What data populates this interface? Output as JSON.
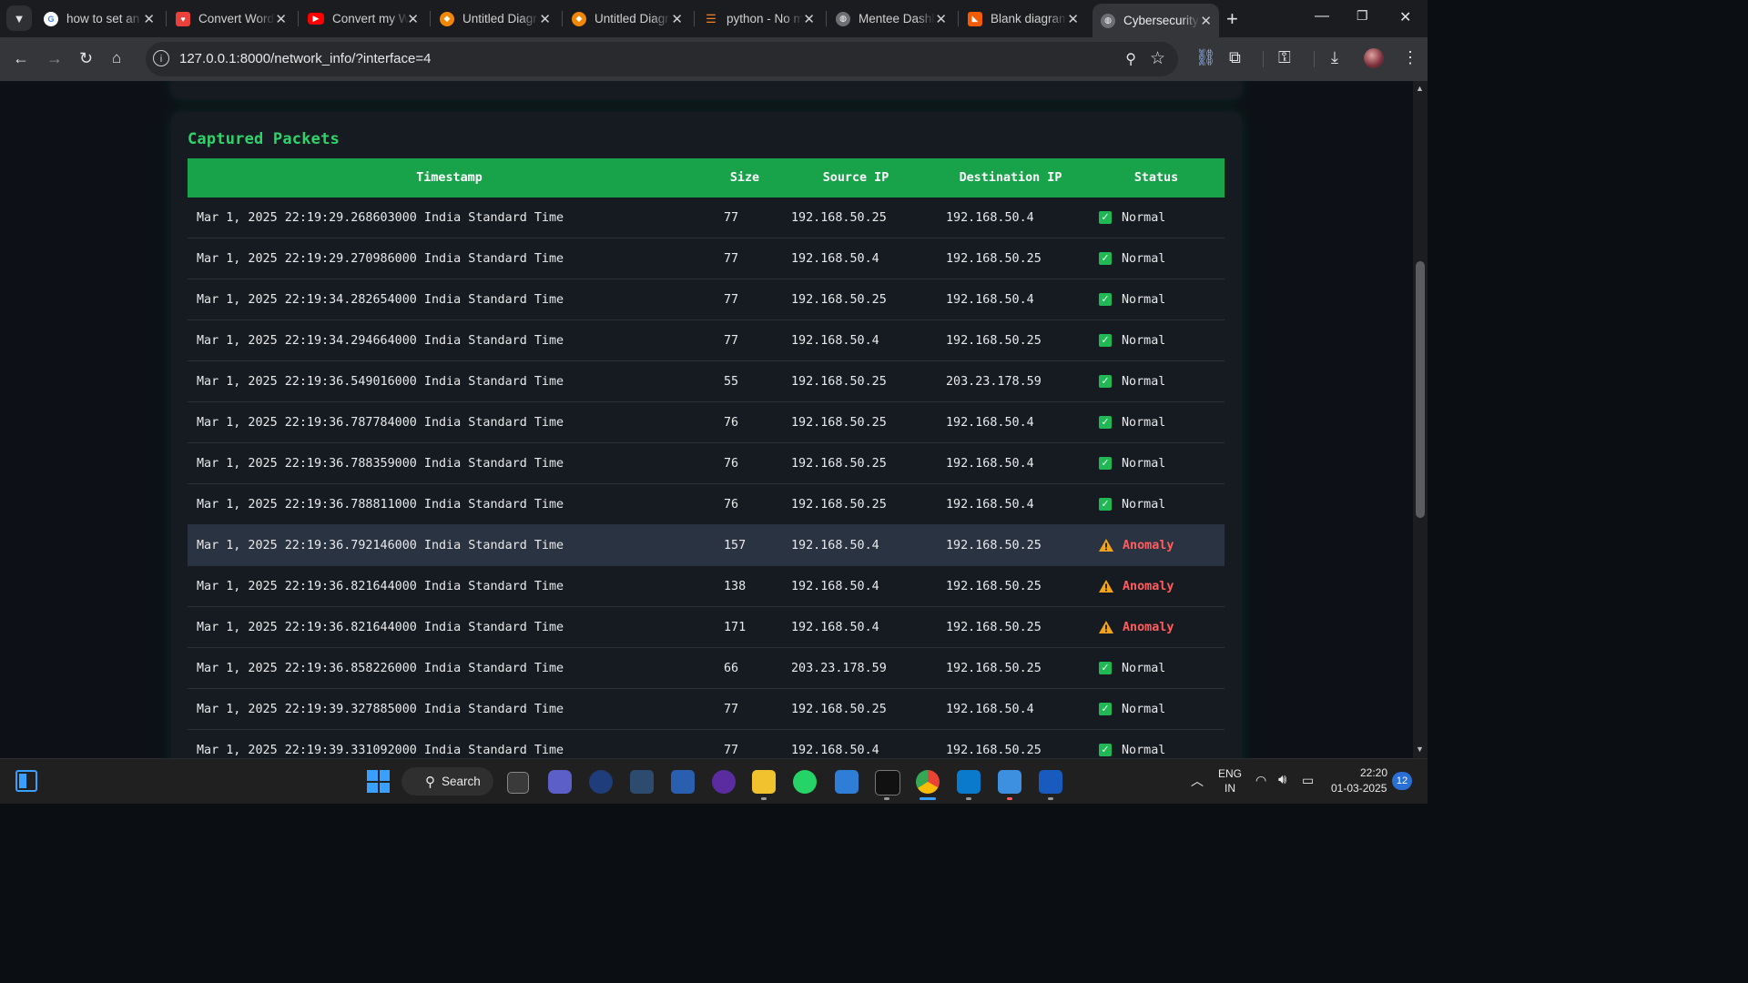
{
  "browser": {
    "tabs": [
      {
        "title": "how to set an",
        "icon": "google-icon"
      },
      {
        "title": "Convert Word",
        "icon": "heart-icon"
      },
      {
        "title": "Convert my Wo",
        "icon": "youtube-icon"
      },
      {
        "title": "Untitled Diagr",
        "icon": "drawio-icon"
      },
      {
        "title": "Untitled Diagr",
        "icon": "drawio-icon"
      },
      {
        "title": "python - No m",
        "icon": "stackoverflow-icon"
      },
      {
        "title": "Mentee Dashb",
        "icon": "globe-icon"
      },
      {
        "title": "Blank diagram",
        "icon": "lucidchart-icon"
      },
      {
        "title": "Cybersecurity",
        "icon": "globe-icon"
      }
    ],
    "url": "127.0.0.1:8000/network_info/?interface=4"
  },
  "page": {
    "section_title": "Captured Packets",
    "columns": [
      "Timestamp",
      "Size",
      "Source IP",
      "Destination IP",
      "Status"
    ],
    "rows": [
      {
        "timestamp": "Mar 1, 2025 22:19:29.268603000 India Standard Time",
        "size": "77",
        "src": "192.168.50.25",
        "dst": "192.168.50.4",
        "status": "Normal"
      },
      {
        "timestamp": "Mar 1, 2025 22:19:29.270986000 India Standard Time",
        "size": "77",
        "src": "192.168.50.4",
        "dst": "192.168.50.25",
        "status": "Normal"
      },
      {
        "timestamp": "Mar 1, 2025 22:19:34.282654000 India Standard Time",
        "size": "77",
        "src": "192.168.50.25",
        "dst": "192.168.50.4",
        "status": "Normal"
      },
      {
        "timestamp": "Mar 1, 2025 22:19:34.294664000 India Standard Time",
        "size": "77",
        "src": "192.168.50.4",
        "dst": "192.168.50.25",
        "status": "Normal"
      },
      {
        "timestamp": "Mar 1, 2025 22:19:36.549016000 India Standard Time",
        "size": "55",
        "src": "192.168.50.25",
        "dst": "203.23.178.59",
        "status": "Normal"
      },
      {
        "timestamp": "Mar 1, 2025 22:19:36.787784000 India Standard Time",
        "size": "76",
        "src": "192.168.50.25",
        "dst": "192.168.50.4",
        "status": "Normal"
      },
      {
        "timestamp": "Mar 1, 2025 22:19:36.788359000 India Standard Time",
        "size": "76",
        "src": "192.168.50.25",
        "dst": "192.168.50.4",
        "status": "Normal"
      },
      {
        "timestamp": "Mar 1, 2025 22:19:36.788811000 India Standard Time",
        "size": "76",
        "src": "192.168.50.25",
        "dst": "192.168.50.4",
        "status": "Normal"
      },
      {
        "timestamp": "Mar 1, 2025 22:19:36.792146000 India Standard Time",
        "size": "157",
        "src": "192.168.50.4",
        "dst": "192.168.50.25",
        "status": "Anomaly",
        "highlighted": true
      },
      {
        "timestamp": "Mar 1, 2025 22:19:36.821644000 India Standard Time",
        "size": "138",
        "src": "192.168.50.4",
        "dst": "192.168.50.25",
        "status": "Anomaly"
      },
      {
        "timestamp": "Mar 1, 2025 22:19:36.821644000 India Standard Time",
        "size": "171",
        "src": "192.168.50.4",
        "dst": "192.168.50.25",
        "status": "Anomaly"
      },
      {
        "timestamp": "Mar 1, 2025 22:19:36.858226000 India Standard Time",
        "size": "66",
        "src": "203.23.178.59",
        "dst": "192.168.50.25",
        "status": "Normal"
      },
      {
        "timestamp": "Mar 1, 2025 22:19:39.327885000 India Standard Time",
        "size": "77",
        "src": "192.168.50.25",
        "dst": "192.168.50.4",
        "status": "Normal"
      },
      {
        "timestamp": "Mar 1, 2025 22:19:39.331092000 India Standard Time",
        "size": "77",
        "src": "192.168.50.4",
        "dst": "192.168.50.25",
        "status": "Normal"
      }
    ]
  },
  "taskbar": {
    "search_label": "Search",
    "lang_line1": "ENG",
    "lang_line2": "IN",
    "time": "22:20",
    "date": "01-03-2025",
    "notification_count": "12"
  },
  "colors": {
    "accent_green": "#18a34a",
    "title_green": "#2fd36a",
    "anomaly_red": "#ff5d5d",
    "warning_amber": "#f2a31b"
  }
}
